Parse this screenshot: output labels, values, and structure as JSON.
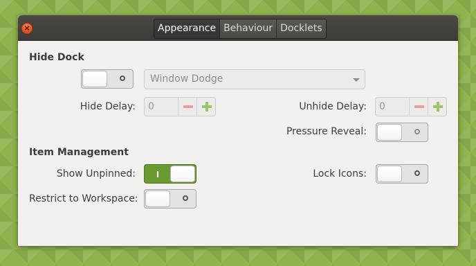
{
  "tabs": [
    {
      "label": "Appearance",
      "active": true
    },
    {
      "label": "Behaviour",
      "active": false
    },
    {
      "label": "Docklets",
      "active": false
    }
  ],
  "close_glyph": "×",
  "hide_dock": {
    "title": "Hide Dock",
    "enabled": false,
    "mode_value": "Window Dodge",
    "hide_delay_label": "Hide Delay:",
    "hide_delay_value": "0",
    "unhide_delay_label": "Unhide Delay:",
    "unhide_delay_value": "0",
    "pressure_reveal_label": "Pressure Reveal:",
    "pressure_reveal_enabled": false
  },
  "item_management": {
    "title": "Item Management",
    "show_unpinned_label": "Show Unpinned:",
    "show_unpinned_enabled": true,
    "lock_icons_label": "Lock Icons:",
    "lock_icons_enabled": false,
    "restrict_label": "Restrict to Workspace:",
    "restrict_enabled": false
  },
  "colors": {
    "accent_green": "#6a9a32",
    "titlebar": "#3c3b37",
    "close_button": "#df4a16",
    "minus": "#e79ea2",
    "plus": "#9bc46e"
  },
  "icons": {
    "close": "close-icon",
    "dropdown": "chevron-down-icon",
    "minus": "minus-icon",
    "plus": "plus-icon"
  }
}
